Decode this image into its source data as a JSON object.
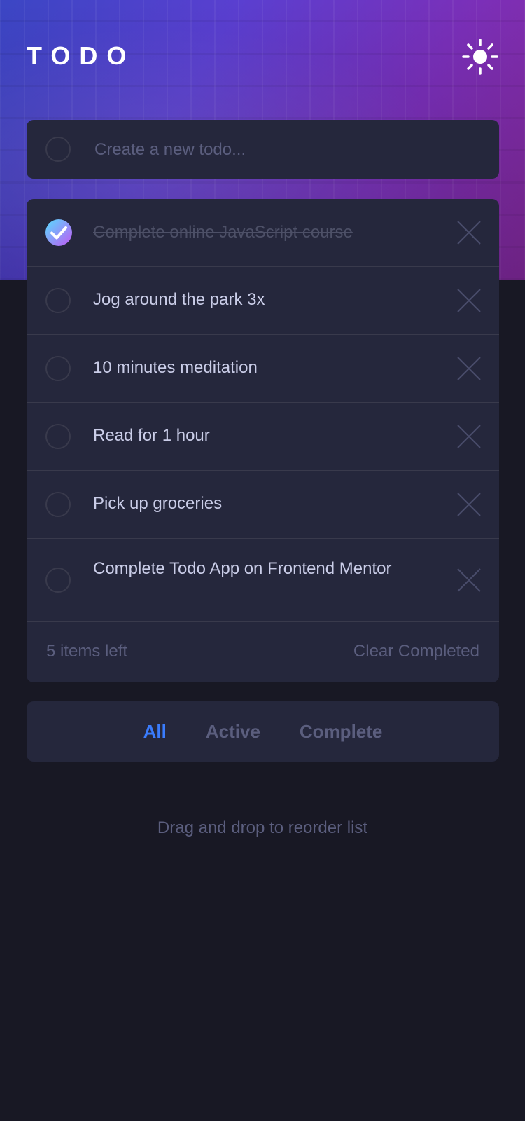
{
  "header": {
    "title": "TODO",
    "theme_icon": "sun-icon"
  },
  "new_todo": {
    "placeholder": "Create a new todo..."
  },
  "todos": [
    {
      "text": "Complete online JavaScript course",
      "completed": true
    },
    {
      "text": "Jog around the park 3x",
      "completed": false
    },
    {
      "text": "10 minutes meditation",
      "completed": false
    },
    {
      "text": "Read for 1 hour",
      "completed": false
    },
    {
      "text": "Pick up groceries",
      "completed": false
    },
    {
      "text": "Complete Todo App on Frontend Mentor",
      "completed": false
    }
  ],
  "footer": {
    "items_left": "5 items left",
    "clear_label": "Clear Completed"
  },
  "filters": {
    "all": "All",
    "active": "Active",
    "complete": "Complete",
    "selected": "All"
  },
  "hint": "Drag and drop to reorder list",
  "colors": {
    "page_bg": "#181824",
    "card_bg": "#25273c",
    "text": "#cacde8",
    "muted": "#5b5e7e",
    "accent_blue": "#3a7cfd",
    "check_gradient_start": "#57ddff",
    "check_gradient_end": "#c058f3"
  }
}
